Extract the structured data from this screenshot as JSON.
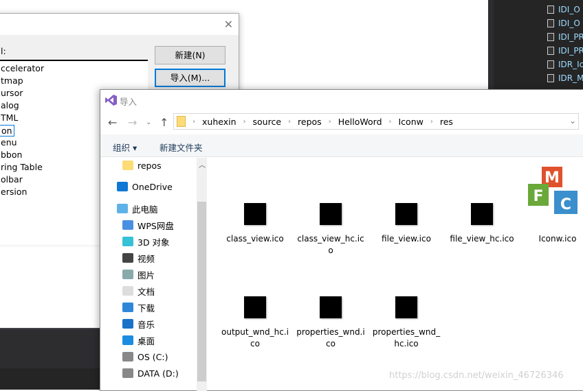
{
  "background_panel": {
    "resources": [
      "IDI_O",
      "IDI_O",
      "IDI_PR",
      "IDI_PR",
      "IDR_Ic",
      "IDR_M"
    ]
  },
  "add_resource_dialog": {
    "close_icon": "close-icon",
    "type_label": "l:",
    "types": [
      "ccelerator",
      "tmap",
      "ursor",
      "alog",
      "TML",
      "on",
      "enu",
      "bbon",
      "ring Table",
      "olbar",
      "ersion"
    ],
    "selected_index": 5,
    "new_button": "新建(N)",
    "import_button": "导入(M)..."
  },
  "import_dialog": {
    "title": "导入",
    "breadcrumb": [
      "xuhexin",
      "source",
      "repos",
      "HelloWord",
      "Iconw",
      "res"
    ],
    "toolbar": {
      "organize": "组织",
      "new_folder": "新建文件夹"
    },
    "nav": [
      {
        "label": "repos",
        "icon": "folder-icon"
      },
      {
        "label": "OneDrive",
        "icon": "cloud-icon"
      },
      {
        "label": "此电脑",
        "icon": "computer-icon"
      },
      {
        "label": "WPS网盘",
        "icon": "wps-cloud-icon"
      },
      {
        "label": "3D 对象",
        "icon": "cube-icon"
      },
      {
        "label": "视频",
        "icon": "video-icon"
      },
      {
        "label": "图片",
        "icon": "picture-icon"
      },
      {
        "label": "文档",
        "icon": "document-icon"
      },
      {
        "label": "下载",
        "icon": "download-icon"
      },
      {
        "label": "音乐",
        "icon": "music-icon"
      },
      {
        "label": "桌面",
        "icon": "desktop-icon"
      },
      {
        "label": "OS (C:)",
        "icon": "drive-icon"
      },
      {
        "label": "DATA (D:)",
        "icon": "drive-icon"
      }
    ],
    "files": [
      "class_view.ico",
      "class_view_hc.ico",
      "file_view.ico",
      "file_view_hc.ico",
      "Iconw.ico",
      "output_wnd_hc.ico",
      "properties_wnd.ico",
      "properties_wnd_hc.ico"
    ]
  },
  "watermark": "https://blog.csdn.net/weixin_46726346"
}
